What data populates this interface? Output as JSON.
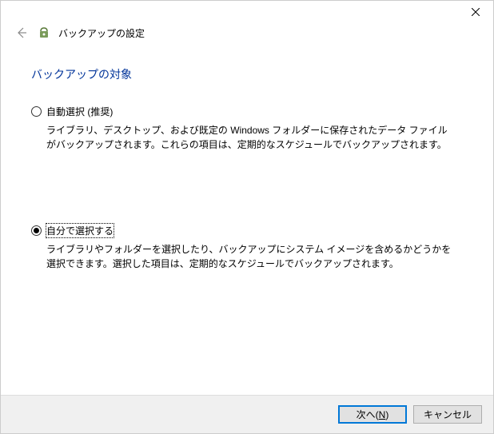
{
  "window": {
    "title": "バックアップの設定"
  },
  "page": {
    "heading": "バックアップの対象"
  },
  "options": {
    "auto": {
      "label": "自動選択 (推奨)",
      "description": "ライブラリ、デスクトップ、および既定の Windows フォルダーに保存されたデータ ファイルがバックアップされます。これらの項目は、定期的なスケジュールでバックアップされます。",
      "selected": false
    },
    "manual": {
      "label": "自分で選択する",
      "description": "ライブラリやフォルダーを選択したり、バックアップにシステム イメージを含めるかどうかを選択できます。選択した項目は、定期的なスケジュールでバックアップされます。",
      "selected": true
    }
  },
  "buttons": {
    "next_prefix": "次へ(",
    "next_hotkey": "N",
    "next_suffix": ")",
    "cancel": "キャンセル"
  }
}
